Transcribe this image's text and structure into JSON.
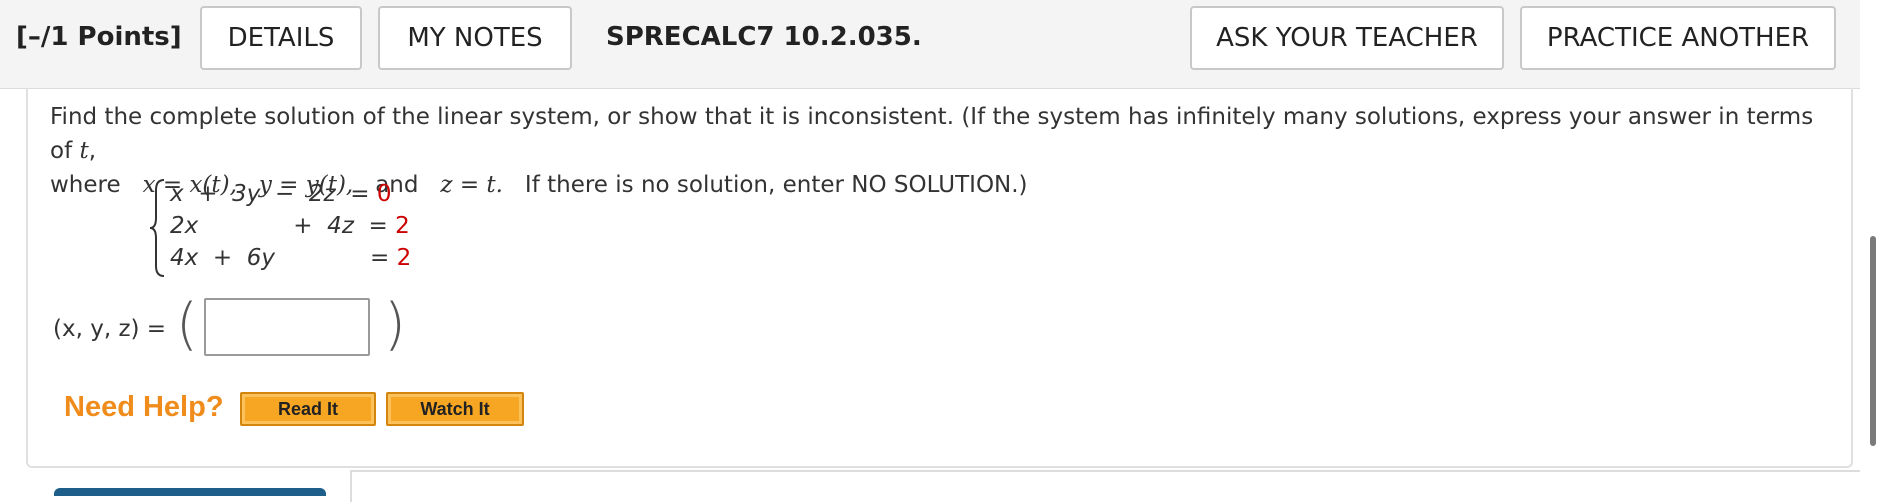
{
  "header": {
    "points": "[–/1 Points]",
    "details_label": "DETAILS",
    "my_notes_label": "MY NOTES",
    "question_id": "SPRECALC7 10.2.035.",
    "ask_teacher_label": "ASK YOUR TEACHER",
    "practice_another_label": "PRACTICE ANOTHER"
  },
  "question": {
    "line1_pre": "Find the complete solution of the linear system, or show that it is inconsistent. (If the system has infinitely many solutions, express your answer in terms of ",
    "line1_var": "t",
    "line1_post": ",",
    "line2_where": "where",
    "line2_xdef": "x = x(t),",
    "line2_ydef": "y = y(t),",
    "line2_and": "and",
    "line2_zdef": "z = t.",
    "line2_post": "If there is no solution, enter NO SOLUTION.)"
  },
  "system": {
    "row1_lhs": "x  +  3y  −  2z  =",
    "row1_rhs": "0",
    "row2_lhs": "2x             +  4z  =",
    "row2_rhs": "2",
    "row3_lhs": "4x  +  6y             =",
    "row3_rhs": "2"
  },
  "answer": {
    "label": "(x, y, z)  =",
    "value": ""
  },
  "help": {
    "label": "Need Help?",
    "read_it": "Read It",
    "watch_it": "Watch It"
  },
  "colors": {
    "accent_orange": "#f08c1c",
    "button_orange": "#f6a623",
    "rhs_red": "#cc0000",
    "bottom_bar_blue": "#1d5f8a"
  }
}
